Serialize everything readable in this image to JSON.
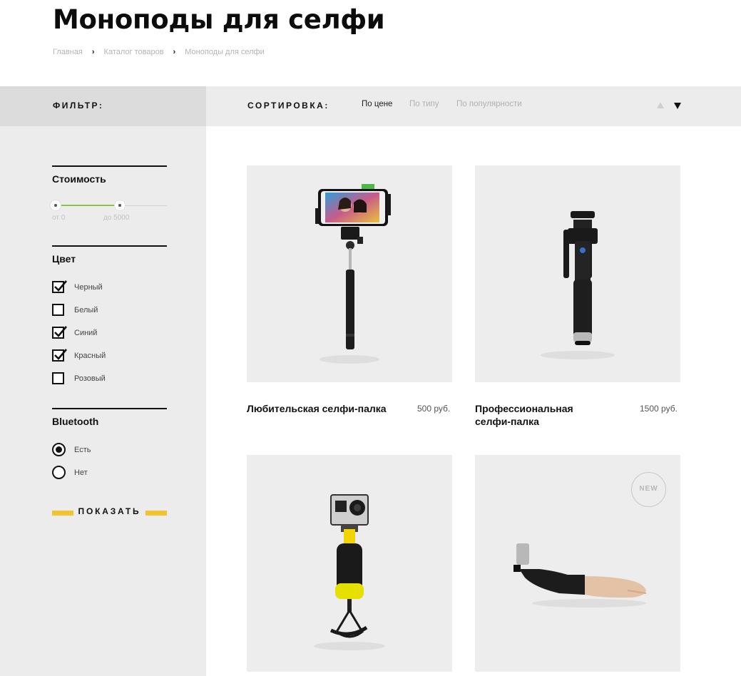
{
  "page": {
    "title": "Моноподы для селфи"
  },
  "breadcrumb": {
    "items": [
      "Главная",
      "Каталог товаров",
      "Моноподы для селфи"
    ],
    "separator": "›"
  },
  "filter": {
    "label": "ФИЛЬТР:"
  },
  "sort": {
    "label": "СОРТИРОВКА:",
    "options": [
      "По цене",
      "По типу",
      "По популярности"
    ],
    "active": "По цене",
    "direction": "descending"
  },
  "filters": {
    "price": {
      "title": "Стоимость",
      "from_label": "от 0",
      "to_label": "до 5000"
    },
    "color": {
      "title": "Цвет",
      "options": [
        {
          "label": "Черный",
          "checked": true
        },
        {
          "label": "Белый",
          "checked": false
        },
        {
          "label": "Синий",
          "checked": true
        },
        {
          "label": "Красный",
          "checked": true
        },
        {
          "label": "Розовый",
          "checked": false
        }
      ]
    },
    "bluetooth": {
      "title": "Bluetooth",
      "options": [
        {
          "label": "Есть",
          "selected": true
        },
        {
          "label": "Нет",
          "selected": false
        }
      ]
    },
    "show_button": "ПОКАЗАТЬ"
  },
  "products": [
    {
      "name": "Любительская селфи-палка",
      "price": "500 руб.",
      "icon": "selfie-stick-phone-image"
    },
    {
      "name_lines": [
        "Профессиональная",
        "селфи-палка"
      ],
      "price": "1500 руб.",
      "icon": "pro-selfie-stick-image"
    },
    {
      "icon": "gopro-floating-grip-image"
    },
    {
      "badge": "NEW",
      "icon": "selfie-arm-image"
    }
  ],
  "colors": {
    "accent_yellow": "#f2c230",
    "range_green": "#8cc63f",
    "sidebar_bg": "#ececec"
  }
}
